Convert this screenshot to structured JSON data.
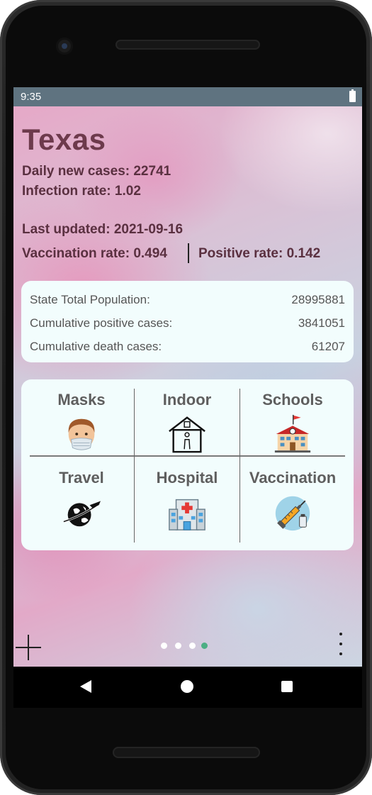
{
  "status_bar": {
    "time": "9:35"
  },
  "state": {
    "name": "Texas",
    "daily_new_cases": "Daily new cases: 22741",
    "infection_rate": "Infection rate: 1.02",
    "last_updated": "Last updated: 2021-09-16",
    "vaccination_rate": "Vaccination rate: 0.494",
    "positive_rate": "Positive rate: 0.142"
  },
  "stats": [
    {
      "label": "State Total Population:",
      "value": "28995881"
    },
    {
      "label": "Cumulative positive cases:",
      "value": "3841051"
    },
    {
      "label": "Cumulative death cases:",
      "value": "61207"
    }
  ],
  "categories": [
    {
      "label": "Masks",
      "icon": "masked-face-icon"
    },
    {
      "label": "Indoor",
      "icon": "house-icon"
    },
    {
      "label": "Schools",
      "icon": "school-icon"
    },
    {
      "label": "Travel",
      "icon": "globe-plane-icon"
    },
    {
      "label": "Hospital",
      "icon": "hospital-icon"
    },
    {
      "label": "Vaccination",
      "icon": "syringe-icon"
    }
  ],
  "pager": {
    "page_count": 4,
    "active_index": 3
  },
  "colors": {
    "status_bar": "#5f7380",
    "card_bg": "#f2fdfd",
    "title": "#6d3a4c",
    "active_dot": "#4caf84"
  }
}
